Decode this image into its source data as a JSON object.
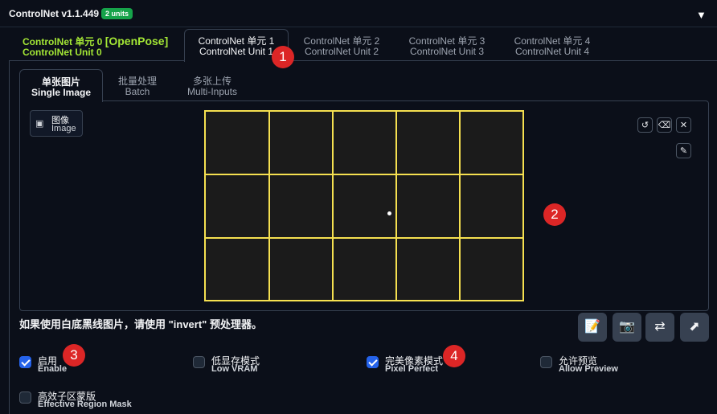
{
  "header": {
    "title": "ControlNet v1.1.449",
    "units_badge": "2 units",
    "collapse_icon": "triangle-down-icon"
  },
  "unit_tabs": [
    {
      "label_cn": "ControlNet 单元 0",
      "label_extra": "[OpenPose]",
      "label_en": "ControlNet Unit 0",
      "color": "#a3e635"
    },
    {
      "label_cn": "ControlNet 单元 1",
      "label_en": "ControlNet Unit 1",
      "active": true
    },
    {
      "label_cn": "ControlNet 单元 2",
      "label_en": "ControlNet Unit 2"
    },
    {
      "label_cn": "ControlNet 单元 3",
      "label_en": "ControlNet Unit 3"
    },
    {
      "label_cn": "ControlNet 单元 4",
      "label_en": "ControlNet Unit 4"
    }
  ],
  "input_tabs": [
    {
      "label_cn": "单张图片",
      "label_en": "Single Image",
      "active": true
    },
    {
      "label_cn": "批量处理",
      "label_en": "Batch"
    },
    {
      "label_cn": "多张上传",
      "label_en": "Multi-Inputs"
    }
  ],
  "image_panel": {
    "label_cn": "图像",
    "label_en": "Image",
    "canvas_border_color": "#f5e050",
    "tools": [
      "undo-icon",
      "eraser-icon",
      "close-icon",
      "brush-icon"
    ]
  },
  "markers": [
    "1",
    "2",
    "3",
    "4"
  ],
  "hint": "如果使用白底黑线图片，请使用 \"invert\" 预处理器。",
  "actions": [
    "edit-icon",
    "camera-icon",
    "swap-icon",
    "send-dimensions-icon"
  ],
  "options": [
    {
      "label_cn": "启用",
      "label_en": "Enable",
      "checked": true
    },
    {
      "label_cn": "低显存模式",
      "label_en": "Low VRAM",
      "checked": false
    },
    {
      "label_cn": "完美像素模式",
      "label_en": "Pixel Perfect",
      "checked": true
    },
    {
      "label_cn": "允许预览",
      "label_en": "Allow Preview",
      "checked": false
    },
    {
      "label_cn": "高效子区蒙版",
      "label_en": "Effective Region Mask",
      "checked": false
    }
  ],
  "colors": {
    "background": "#0b0f19",
    "accent": "#2563eb",
    "marker": "#dc2626",
    "badge": "#16a34a"
  }
}
